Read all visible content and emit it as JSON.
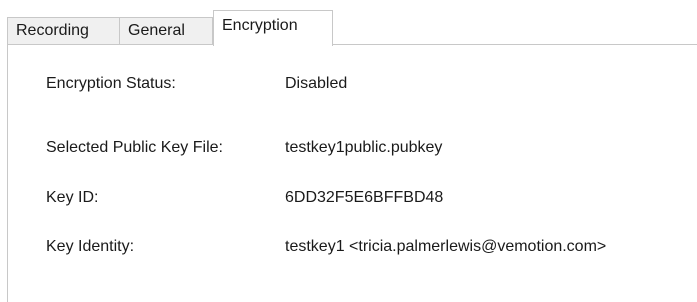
{
  "tabs": [
    {
      "label": "Recording"
    },
    {
      "label": "General"
    },
    {
      "label": "Encryption",
      "selected": true
    }
  ],
  "encryption": {
    "status_label": "Encryption Status:",
    "status_value": "Disabled",
    "pubkey_label": "Selected Public Key File:",
    "pubkey_value": "testkey1public.pubkey",
    "keyid_label": "Key ID:",
    "keyid_value": "6DD32F5E6BFFBD48",
    "identity_label": "Key Identity:",
    "identity_value": "testkey1 <tricia.palmerlewis@vemotion.com>"
  }
}
